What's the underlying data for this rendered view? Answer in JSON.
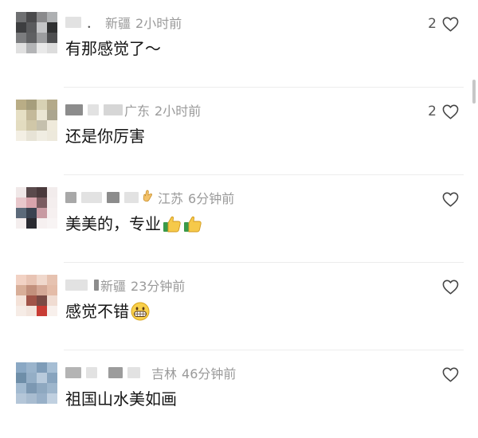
{
  "comments": [
    {
      "region": "新疆",
      "time": "2小时前",
      "text": "有那感觉了～",
      "likes": "2",
      "username_prefix": "．",
      "avatar_colors": [
        "#6f7072",
        "#4a4a4c",
        "#8a8a8c",
        "#aeb0b2",
        "#3d3e40",
        "#5a5b5d",
        "#c4c5c7",
        "#2f3031",
        "#7b7c7e",
        "#5f6062",
        "#9c9d9f",
        "#4d4e50",
        "#e0e0e0",
        "#b3b4b6",
        "#e9e9e9",
        "#dcdcdc"
      ],
      "emoji": []
    },
    {
      "region": "广东",
      "time": "2小时前",
      "text": "还是你厉害",
      "likes": "2",
      "avatar_colors": [
        "#b9ad86",
        "#a69e7c",
        "#d8d2b4",
        "#b4aa8a",
        "#e6dfc4",
        "#c4b99a",
        "#ebe6d4",
        "#aba58f",
        "#e3dcc0",
        "#d0c7a8",
        "#c5c0ad",
        "#efeadb",
        "#f3efe4",
        "#e7e3d6",
        "#f0ede2",
        "#ede9dc"
      ],
      "emoji": []
    },
    {
      "region": "江苏",
      "time": "6分钟前",
      "text": "美美的，专业",
      "likes": "",
      "avatar_colors": [
        "#f0e8e8",
        "#5a4a4c",
        "#4a3a3c",
        "#f2ecec",
        "#e8c8cc",
        "#d8a4ac",
        "#7a5c60",
        "#f4eeee",
        "#5c6a7a",
        "#3a4250",
        "#c89aa2",
        "#f6f0f0",
        "#f4eeee",
        "#2a2a30",
        "#f6f0f0",
        "#f8f4f4"
      ],
      "emoji": [
        "thumbs-up-icon",
        "thumbs-up-icon"
      ]
    },
    {
      "region": "新疆",
      "time": "23分钟前",
      "text": "感觉不错",
      "likes": "",
      "avatar_colors": [
        "#f2d2c4",
        "#e8c4b4",
        "#f0d8cc",
        "#e6c2b0",
        "#d8ae98",
        "#c2907c",
        "#d4a896",
        "#e4bca8",
        "#f4e2d8",
        "#a05448",
        "#7a4a44",
        "#f0dcd2",
        "#f6ece6",
        "#f2e4dc",
        "#c83c34",
        "#f8f0ec"
      ],
      "emoji": [
        "grinning-face-icon"
      ]
    },
    {
      "region": "吉林",
      "time": "46分钟前",
      "text": "祖国山水美如画",
      "likes": "",
      "avatar_colors": [
        "#8aa8c4",
        "#9ab4cc",
        "#7e9cb8",
        "#a6bed4",
        "#6e8ea8",
        "#94aec6",
        "#b8cadc",
        "#88a4be",
        "#a2bad0",
        "#7c98b2",
        "#8ea8c0",
        "#9eb6cc",
        "#b4c6d8",
        "#a8bcd0",
        "#98b0c8",
        "#c0d0e0"
      ],
      "emoji": []
    }
  ],
  "icons": {
    "like": "heart-outline-icon"
  },
  "colors": {
    "meta_text": "#9a9a9a",
    "body_text": "#151515",
    "divider": "#ececec"
  }
}
